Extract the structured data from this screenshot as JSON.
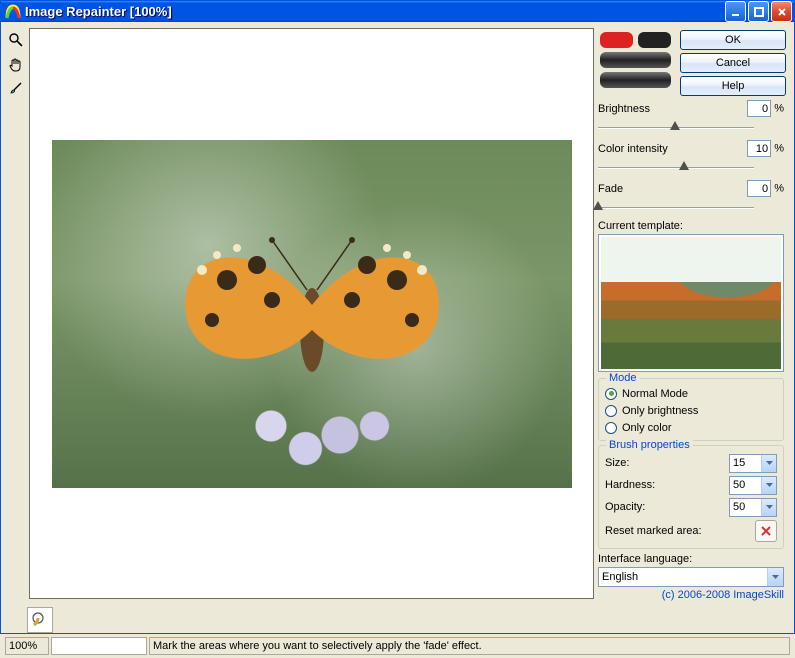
{
  "title": "Image Repainter [100%]",
  "buttons": {
    "ok": "OK",
    "cancel": "Cancel",
    "help": "Help"
  },
  "sliders": {
    "brightness": {
      "label": "Brightness",
      "value": "0",
      "suffix": "%",
      "pos": 50
    },
    "colorintensity": {
      "label": "Color intensity",
      "value": "10",
      "suffix": "%",
      "pos": 55
    },
    "fade": {
      "label": "Fade",
      "value": "0",
      "suffix": "%",
      "pos": 0
    }
  },
  "current_template_label": "Current template:",
  "mode": {
    "legend": "Mode",
    "opts": [
      "Normal Mode",
      "Only brightness",
      "Only color"
    ],
    "selected": 0
  },
  "brush": {
    "legend": "Brush properties",
    "size_label": "Size:",
    "size_value": "15",
    "hardness_label": "Hardness:",
    "hardness_value": "50",
    "opacity_label": "Opacity:",
    "opacity_value": "50",
    "reset_label": "Reset marked area:"
  },
  "language": {
    "label": "Interface language:",
    "value": "English"
  },
  "copyright": "(c) 2006-2008 ImageSkill",
  "status": {
    "zoom": "100%",
    "hint": "Mark the areas where you want to selectively apply the 'fade' effect."
  }
}
